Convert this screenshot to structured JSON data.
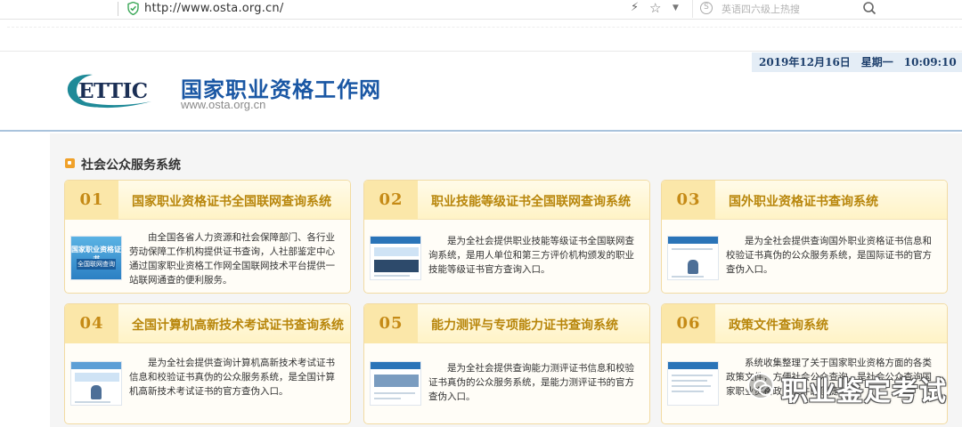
{
  "browser": {
    "url": "http://www.osta.org.cn/",
    "search_placeholder": "英语四六级上热搜"
  },
  "header": {
    "datetime": "2019年12月16日　星期一　10:09:10",
    "logo_text": "ETTIC",
    "site_title": "国家职业资格工作网",
    "site_url": "www.osta.org.cn"
  },
  "section": {
    "title": "社会公众服务系统"
  },
  "cards": [
    {
      "num": "01",
      "title": "国家职业资格证书全国联网查询系统",
      "desc": "由全国各省人力资源和社会保障部门、各行业劳动保障工作机构提供证书查询，人社部鉴定中心通过国家职业资格工作网全国联网技术平台提供一站联网通查的便利服务。",
      "thumb_line1": "国家职业资格证书",
      "thumb_line2": "全国联网查询"
    },
    {
      "num": "02",
      "title": "职业技能等级证书全国联网查询系统",
      "desc": "是为全社会提供职业技能等级证书全国联网查询系统，是用人单位和第三方评价机构颁发的职业技能等级证书官方查询入口。"
    },
    {
      "num": "03",
      "title": "国外职业资格证书查询系统",
      "desc": "是为全社会提供查询国外职业资格证书信息和校验证书真伪的公众服务系统，是国际证书的官方查伪入口。"
    },
    {
      "num": "04",
      "title": "全国计算机高新技术考试证书查询系统",
      "desc": "是为全社会提供查询计算机高新技术考试证书信息和校验证书真伪的公众服务系统，是全国计算机高新技术考试证书的官方查伪入口。"
    },
    {
      "num": "05",
      "title": "能力测评与专项能力证书查询系统",
      "desc": "是为全社会提供查询能力测评证书信息和校验证书真伪的公众服务系统，是能力测评证书的官方查伪入口。"
    },
    {
      "num": "06",
      "title": "政策文件查询系统",
      "desc": "系统收集整理了关于国家职业资格方面的各类政策文件，方便社会公众查询，是社会公众查询国家职业资格政策文件的便捷工具。"
    }
  ],
  "watermark": {
    "text": "职业鉴定考试"
  },
  "colors": {
    "accent_blue": "#1a57a4",
    "card_gold": "#b8860b",
    "card_border": "#f2dba2"
  }
}
